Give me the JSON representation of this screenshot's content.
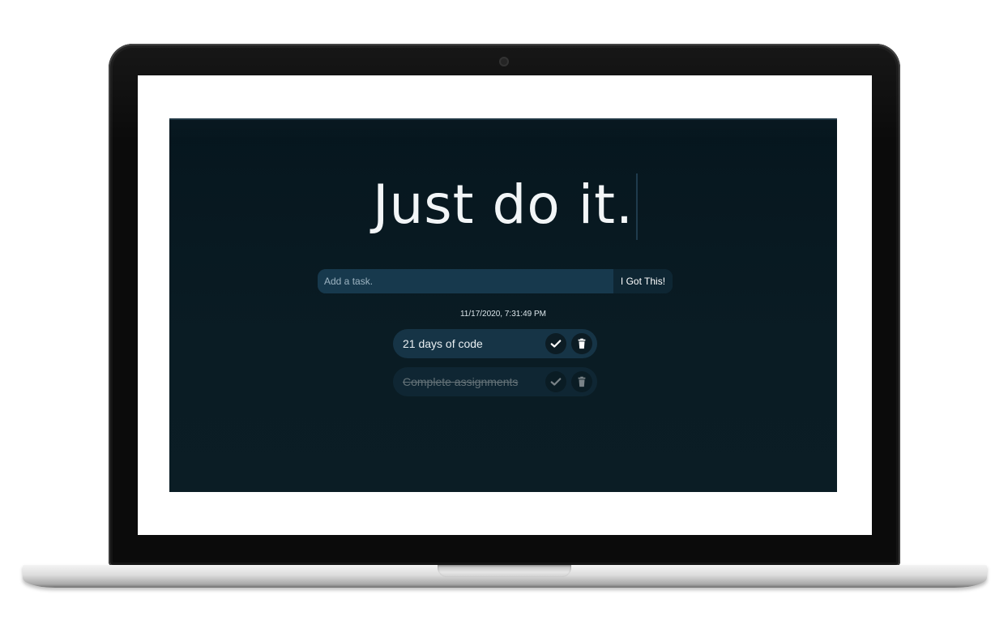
{
  "app": {
    "headline": "Just do it.",
    "input": {
      "placeholder": "Add a task.",
      "value": ""
    },
    "submit_label": "I Got This!",
    "timestamp": "11/17/2020, 7:31:49 PM",
    "tasks": [
      {
        "text": "21 days of code",
        "completed": false
      },
      {
        "text": "Complete assignments",
        "completed": true
      }
    ]
  },
  "icons": {
    "complete": "check-icon",
    "delete": "trash-icon"
  },
  "colors": {
    "background": "#06161e",
    "task_pill": "#163446",
    "input_bg": "#17394d",
    "button_bg": "#0e2633",
    "text": "#f2f5f7"
  }
}
